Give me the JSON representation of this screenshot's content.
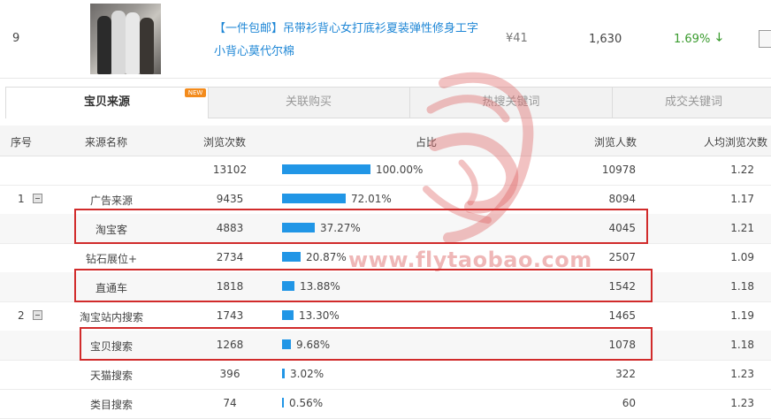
{
  "product": {
    "rank": "9",
    "title": "【一件包邮】吊带衫背心女打底衫夏装弹性修身工字小背心莫代尔棉",
    "price": "¥41",
    "views": "1,630",
    "conversion": "1.69%",
    "trend_icon": "down-arrow-icon"
  },
  "tabs": [
    {
      "label": "宝贝来源",
      "active": true,
      "badge": "NEW"
    },
    {
      "label": "关联购买",
      "active": false
    },
    {
      "label": "热搜关键词",
      "active": false
    },
    {
      "label": "成交关键词",
      "active": false
    }
  ],
  "table": {
    "headers": {
      "idx": "序号",
      "name": "来源名称",
      "views": "浏览次数",
      "pct": "占比",
      "uv": "浏览人数",
      "avg": "人均浏览次数"
    },
    "rows": [
      {
        "idx": "",
        "name": "",
        "views": "13102",
        "pct": "100.00%",
        "share": 1.0,
        "uv": "10978",
        "avg": "1.22",
        "toggle": false,
        "highlight": false
      },
      {
        "idx": "1",
        "name": "广告来源",
        "views": "9435",
        "pct": "72.01%",
        "share": 0.7201,
        "uv": "8094",
        "avg": "1.17",
        "toggle": true,
        "highlight": false
      },
      {
        "idx": "",
        "name": "淘宝客",
        "views": "4883",
        "pct": "37.27%",
        "share": 0.3727,
        "uv": "4045",
        "avg": "1.21",
        "toggle": false,
        "highlight": true
      },
      {
        "idx": "",
        "name": "钻石展位+",
        "views": "2734",
        "pct": "20.87%",
        "share": 0.2087,
        "uv": "2507",
        "avg": "1.09",
        "toggle": false,
        "highlight": false
      },
      {
        "idx": "",
        "name": "直通车",
        "views": "1818",
        "pct": "13.88%",
        "share": 0.1388,
        "uv": "1542",
        "avg": "1.18",
        "toggle": false,
        "highlight": true
      },
      {
        "idx": "2",
        "name": "淘宝站内搜索",
        "views": "1743",
        "pct": "13.30%",
        "share": 0.133,
        "uv": "1465",
        "avg": "1.19",
        "toggle": true,
        "highlight": false
      },
      {
        "idx": "",
        "name": "宝贝搜索",
        "views": "1268",
        "pct": "9.68%",
        "share": 0.0968,
        "uv": "1078",
        "avg": "1.18",
        "toggle": false,
        "highlight": true
      },
      {
        "idx": "",
        "name": "天猫搜索",
        "views": "396",
        "pct": "3.02%",
        "share": 0.0302,
        "uv": "322",
        "avg": "1.23",
        "toggle": false,
        "highlight": false
      },
      {
        "idx": "",
        "name": "类目搜索",
        "views": "74",
        "pct": "0.56%",
        "share": 0.0056,
        "uv": "60",
        "avg": "1.23",
        "toggle": false,
        "highlight": false
      }
    ]
  },
  "watermark": {
    "url": "www.flytaobao.com",
    "color": "#dc5f5f"
  },
  "colors": {
    "bar": "#2196e6",
    "link": "#1f87d6",
    "up": "#3a9b2e",
    "highlight": "#d12b2b",
    "badge": "#f38b1c"
  }
}
